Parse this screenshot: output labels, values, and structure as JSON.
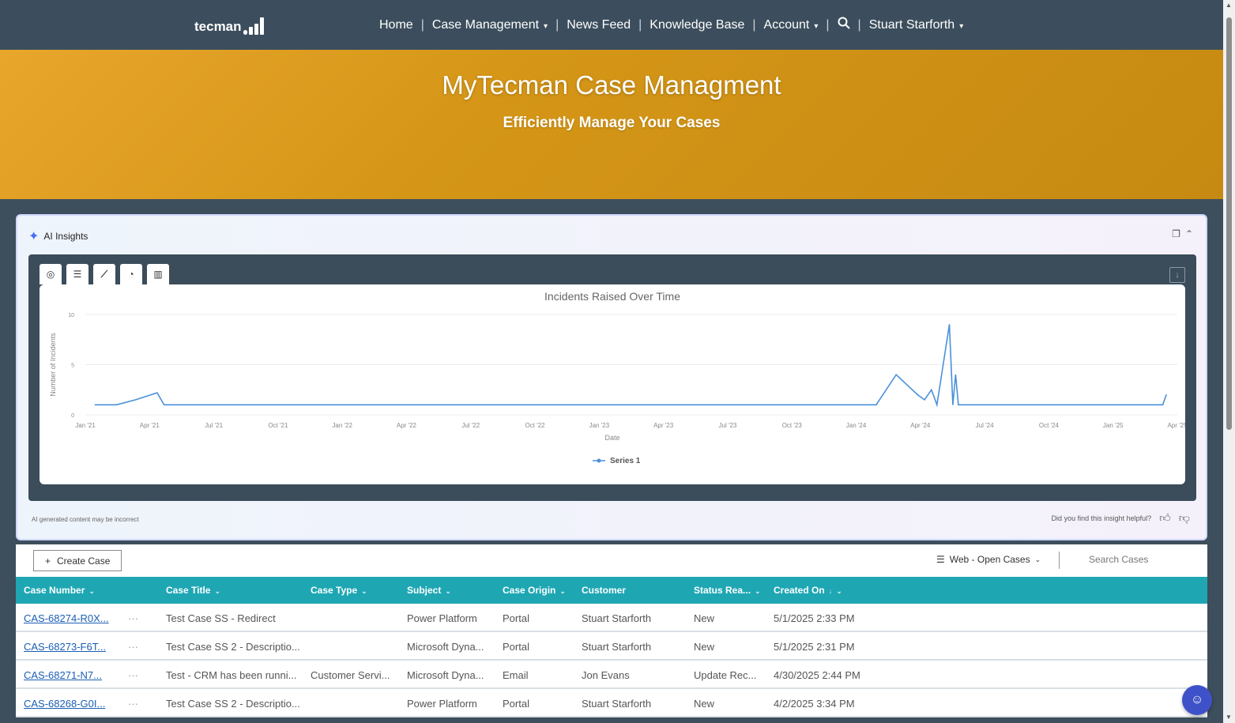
{
  "brand": {
    "logo_text": "tecman"
  },
  "nav": {
    "items": [
      {
        "label": "Home",
        "caret": false
      },
      {
        "label": "Case Management",
        "caret": true
      },
      {
        "label": "News Feed",
        "caret": false
      },
      {
        "label": "Knowledge Base",
        "caret": false
      },
      {
        "label": "Account",
        "caret": true
      }
    ],
    "user": "Stuart Starforth",
    "caret": "▾"
  },
  "banner": {
    "title": "MyTecman Case Managment",
    "subtitle": "Efficiently Manage Your Cases"
  },
  "ai_card": {
    "title": "AI Insights",
    "disclaimer": "AI generated content may be incorrect",
    "feedback_prompt": "Did you find this insight helpful?"
  },
  "chart_tabs": [
    "table-view",
    "summary-view",
    "line-chart",
    "pie-chart",
    "bar-chart"
  ],
  "chart_data": {
    "type": "line",
    "title": "Incidents Raised Over Time",
    "xlabel": "Date",
    "ylabel": "Number of Incidents",
    "ylim": [
      0,
      10
    ],
    "yticks": [
      0,
      5,
      10
    ],
    "xlim": [
      "2021-01-01",
      "2025-05-01"
    ],
    "xticks": [
      "Jan '21",
      "Apr '21",
      "Jul '21",
      "Oct '21",
      "Jan '22",
      "Apr '22",
      "Jul '22",
      "Oct '22",
      "Jan '23",
      "Apr '23",
      "Jul '23",
      "Oct '23",
      "Jan '24",
      "Apr '24",
      "Jul '24",
      "Oct '24",
      "Jan '25",
      "Apr '25"
    ],
    "grid": true,
    "legend": "bottom",
    "series": [
      {
        "name": "Series 1",
        "color": "#4a90d9",
        "points": [
          [
            "2021-01-15",
            1
          ],
          [
            "2021-02-15",
            1
          ],
          [
            "2021-03-15",
            1.5
          ],
          [
            "2021-04-15",
            2.2
          ],
          [
            "2021-04-25",
            1
          ],
          [
            "2021-06-01",
            1
          ],
          [
            "2023-12-31",
            1
          ],
          [
            "2024-02-20",
            1
          ],
          [
            "2024-03-20",
            4
          ],
          [
            "2024-04-20",
            2
          ],
          [
            "2024-04-30",
            1.5
          ],
          [
            "2024-05-10",
            2.5
          ],
          [
            "2024-05-18",
            1
          ],
          [
            "2024-06-05",
            9
          ],
          [
            "2024-06-10",
            1
          ],
          [
            "2024-06-14",
            4
          ],
          [
            "2024-06-18",
            1
          ],
          [
            "2025-04-10",
            1
          ],
          [
            "2025-04-15",
            2
          ]
        ]
      }
    ]
  },
  "toolbar": {
    "create_label": "Create Case",
    "view_label": "Web - Open Cases",
    "search_placeholder": "Search Cases"
  },
  "table": {
    "columns": [
      "Case Number",
      "Case Title",
      "Case Type",
      "Subject",
      "Case Origin",
      "Customer",
      "Status Rea...",
      "Created On"
    ],
    "rows": [
      {
        "number": "CAS-68274-R0X...",
        "title": "Test Case SS - Redirect",
        "type": "",
        "subject": "Power Platform",
        "origin": "Portal",
        "customer": "Stuart Starforth",
        "status": "New",
        "created": "5/1/2025 2:33 PM"
      },
      {
        "number": "CAS-68273-F6T...",
        "title": "Test Case SS 2 - Descriptio...",
        "type": "",
        "subject": "Microsoft Dyna...",
        "origin": "Portal",
        "customer": "Stuart Starforth",
        "status": "New",
        "created": "5/1/2025 2:31 PM"
      },
      {
        "number": "CAS-68271-N7...",
        "title": "Test - CRM has been runni...",
        "type": "Customer Servi...",
        "subject": "Microsoft Dyna...",
        "origin": "Email",
        "customer": "Jon Evans",
        "status": "Update Rec...",
        "created": "4/30/2025 2:44 PM"
      },
      {
        "number": "CAS-68268-G0I...",
        "title": "Test Case SS 2 - Descriptio...",
        "type": "",
        "subject": "Power Platform",
        "origin": "Portal",
        "customer": "Stuart Starforth",
        "status": "New",
        "created": "4/2/2025 3:34 PM"
      }
    ]
  }
}
